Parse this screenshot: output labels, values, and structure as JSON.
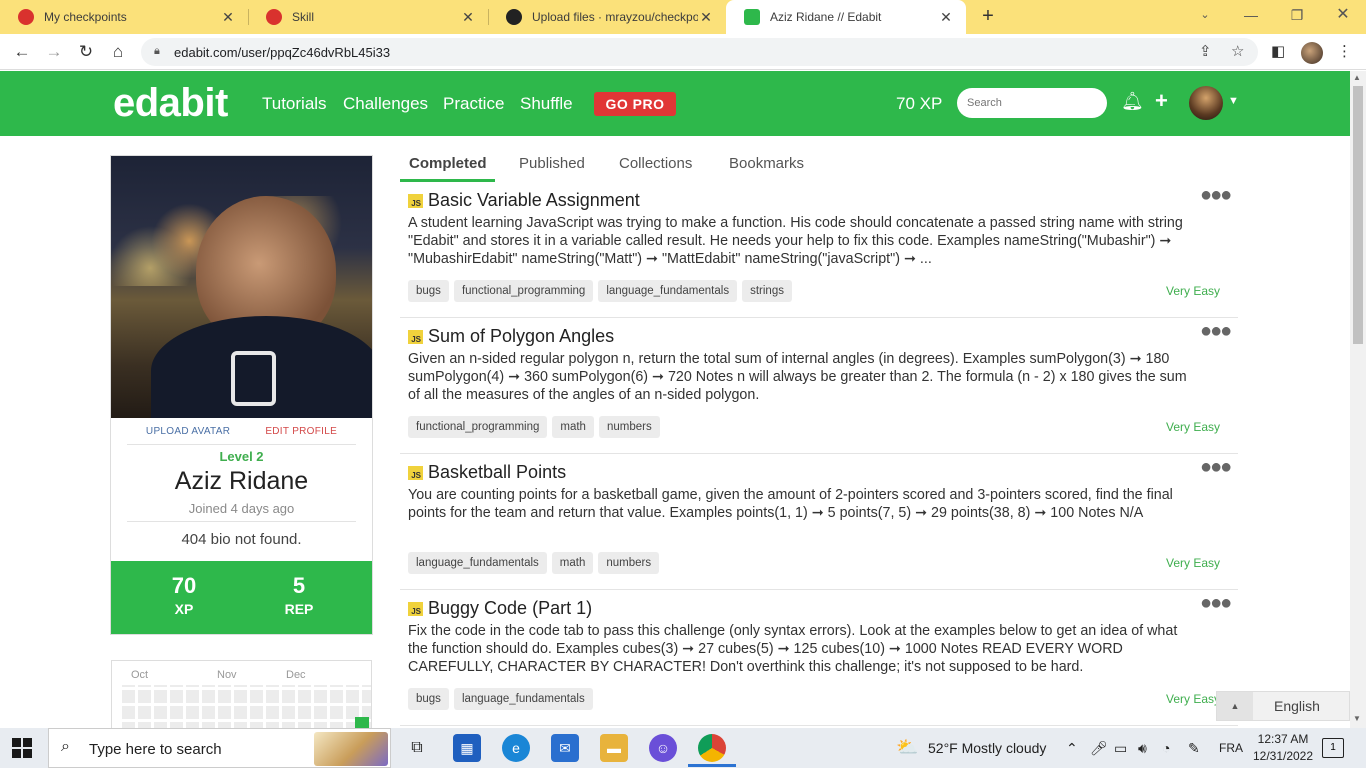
{
  "browser": {
    "tabs": [
      {
        "title": "My checkpoints",
        "icon": "opera-icon",
        "color": "#d9322e"
      },
      {
        "title": "Skill",
        "icon": "opera-icon",
        "color": "#d9322e"
      },
      {
        "title": "Upload files · mrayzou/checkpoin",
        "icon": "github-icon",
        "color": "#222222"
      },
      {
        "title": "Aziz Ridane // Edabit",
        "icon": "edabit-icon",
        "color": "#2eb84b"
      }
    ],
    "url": "edabit.com/user/ppqZc46dvRbL45i33"
  },
  "header": {
    "logo": "edabit",
    "nav": [
      "Tutorials",
      "Challenges",
      "Practice",
      "Shuffle"
    ],
    "gopro": "GO PRO",
    "xp": "70 XP",
    "search_placeholder": "Search"
  },
  "profile": {
    "upload_avatar": "UPLOAD AVATAR",
    "edit_profile": "EDIT PROFILE",
    "level": "Level 2",
    "name": "Aziz Ridane",
    "joined": "Joined 4 days ago",
    "bio": "404 bio not found.",
    "stats": [
      {
        "value": "70",
        "label": "XP"
      },
      {
        "value": "5",
        "label": "REP"
      }
    ],
    "activity_months": [
      "Oct",
      "Nov",
      "Dec"
    ]
  },
  "content_tabs": [
    "Completed",
    "Published",
    "Collections",
    "Bookmarks"
  ],
  "challenges": [
    {
      "lang": "JS",
      "title": "Basic Variable Assignment",
      "description": "A student learning JavaScript was trying to make a function. His code should concatenate a passed string name with string \"Edabit\" and stores it in a variable called result. He needs your help to fix this code. Examples nameString(\"Mubashir\") ➞ \"MubashirEdabit\" nameString(\"Matt\") ➞ \"MattEdabit\" nameString(\"javaScript\") ➞ ...",
      "tags": [
        "bugs",
        "functional_programming",
        "language_fundamentals",
        "strings"
      ],
      "difficulty": "Very Easy"
    },
    {
      "lang": "JS",
      "title": "Sum of Polygon Angles",
      "description": "Given an n-sided regular polygon n, return the total sum of internal angles (in degrees). Examples sumPolygon(3) ➞ 180 sumPolygon(4) ➞ 360 sumPolygon(6) ➞ 720 Notes n will always be greater than 2. The formula (n - 2) x 180 gives the sum of all the measures of the angles of an n-sided polygon.",
      "tags": [
        "functional_programming",
        "math",
        "numbers"
      ],
      "difficulty": "Very Easy"
    },
    {
      "lang": "JS",
      "title": "Basketball Points",
      "description": "You are counting points for a basketball game, given the amount of 2-pointers scored and 3-pointers scored, find the final points for the team and return that value. Examples points(1, 1) ➞ 5 points(7, 5) ➞ 29 points(38, 8) ➞ 100 Notes N/A",
      "tags": [
        "language_fundamentals",
        "math",
        "numbers"
      ],
      "difficulty": "Very Easy"
    },
    {
      "lang": "JS",
      "title": "Buggy Code (Part 1)",
      "description": "Fix the code in the code tab to pass this challenge (only syntax errors). Look at the examples below to get an idea of what the function should do. Examples cubes(3) ➞ 27 cubes(5) ➞ 125 cubes(10) ➞ 1000 Notes READ EVERY WORD CAREFULLY, CHARACTER BY CHARACTER! Don't overthink this challenge; it's not supposed to be hard.",
      "tags": [
        "bugs",
        "language_fundamentals"
      ],
      "difficulty": "Very Easy"
    }
  ],
  "language_button": "English",
  "taskbar": {
    "search_placeholder": "Type here to search",
    "weather": "52°F  Mostly cloudy",
    "keyboard_lang": "FRA",
    "time": "12:37 AM",
    "date": "12/31/2022",
    "notification_count": "1"
  },
  "colors": {
    "edabit_green": "#2eb84b",
    "tab_bar_yellow": "#fbe17a",
    "gopro_red": "#e13636"
  }
}
